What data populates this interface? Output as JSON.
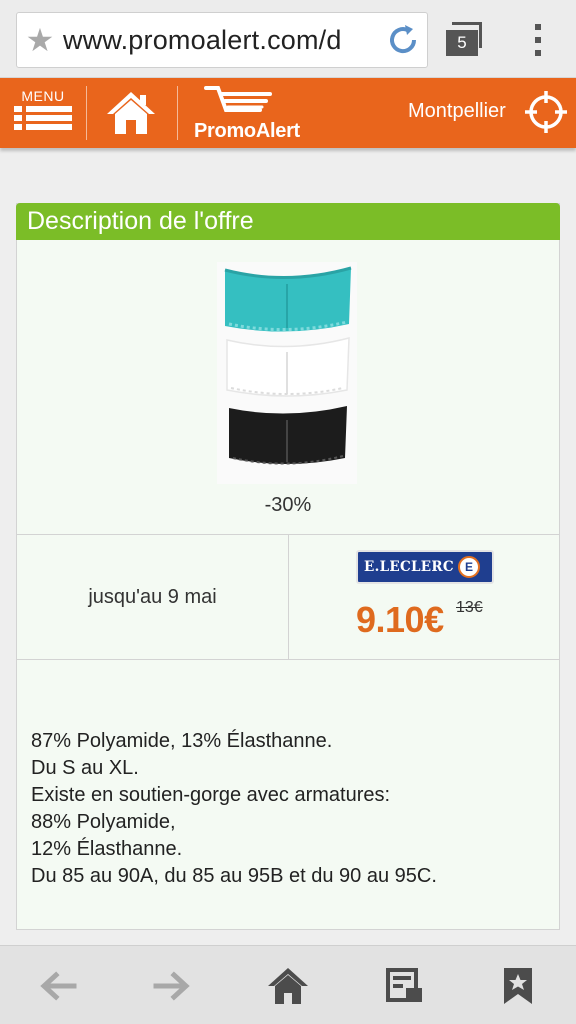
{
  "browser": {
    "url": "www.promoalert.com/d",
    "tab_count": "5"
  },
  "header": {
    "menu_label": "MENU",
    "logo_text": "PromoAlert",
    "city": "Montpellier",
    "accent_color": "#e9651c"
  },
  "offer": {
    "section_title": "Description de l'offre",
    "section_color": "#7bbd27",
    "discount": "-30%",
    "validity": "jusqu'au 9 mai",
    "store": {
      "name": "E.LECLERC",
      "badge": "E"
    },
    "price_new": "9.10€",
    "price_old": "13€",
    "price_color": "#df6a1e",
    "description": "87% Polyamide, 13% Élasthanne.\nDu S au XL.\nExiste en soutien-gorge avec armatures:\n88% Polyamide,\n12% Élasthanne.\nDu 85 au 90A, du 85 au 95B et du 90 au 95C."
  },
  "bottom_nav": {
    "icons": [
      "back-arrow-icon",
      "forward-arrow-icon",
      "home-icon",
      "reading-list-icon",
      "bookmark-icon"
    ]
  }
}
